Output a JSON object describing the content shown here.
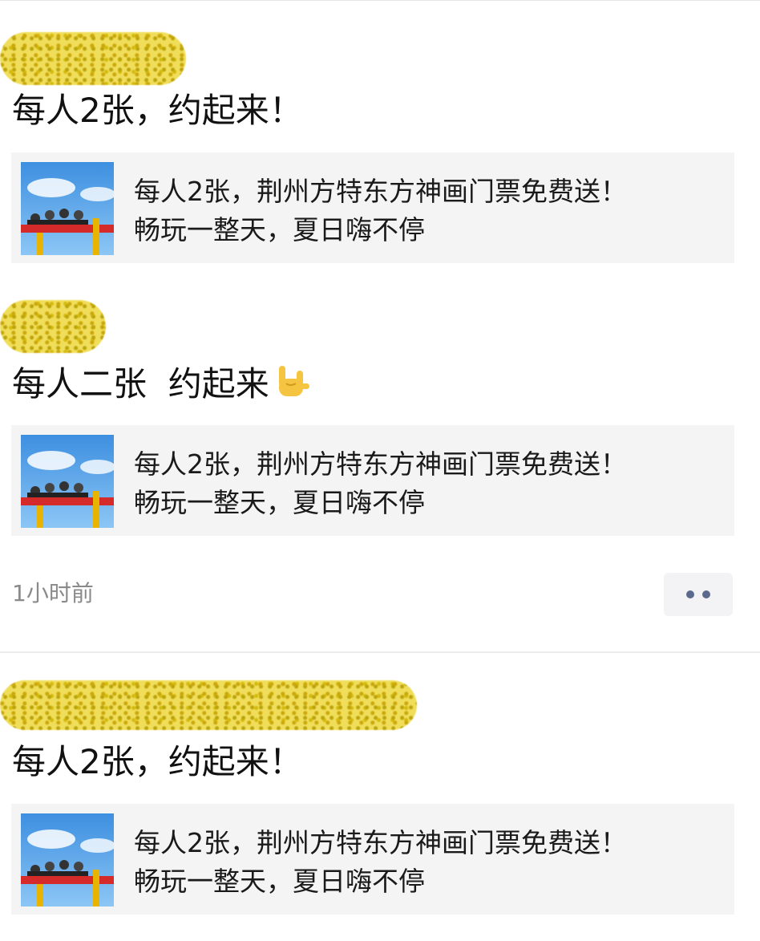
{
  "posts": [
    {
      "text": "每人2张，约起来！"
    },
    {
      "text": "每人二张  约起来"
    },
    {
      "text": "每人2张，约起来！"
    }
  ],
  "link_card": {
    "line1": "每人2张，荆州方特东方神画门票免费送！",
    "line2": "畅玩一整天，夏日嗨不停"
  },
  "timestamp": "1小时前",
  "emoji": "love-you-gesture-icon",
  "colors": {
    "card_bg": "#f4f4f4",
    "more_dots": "#5b6a8c",
    "timestamp": "#8a8a8a",
    "redaction": "#f0dc52"
  }
}
